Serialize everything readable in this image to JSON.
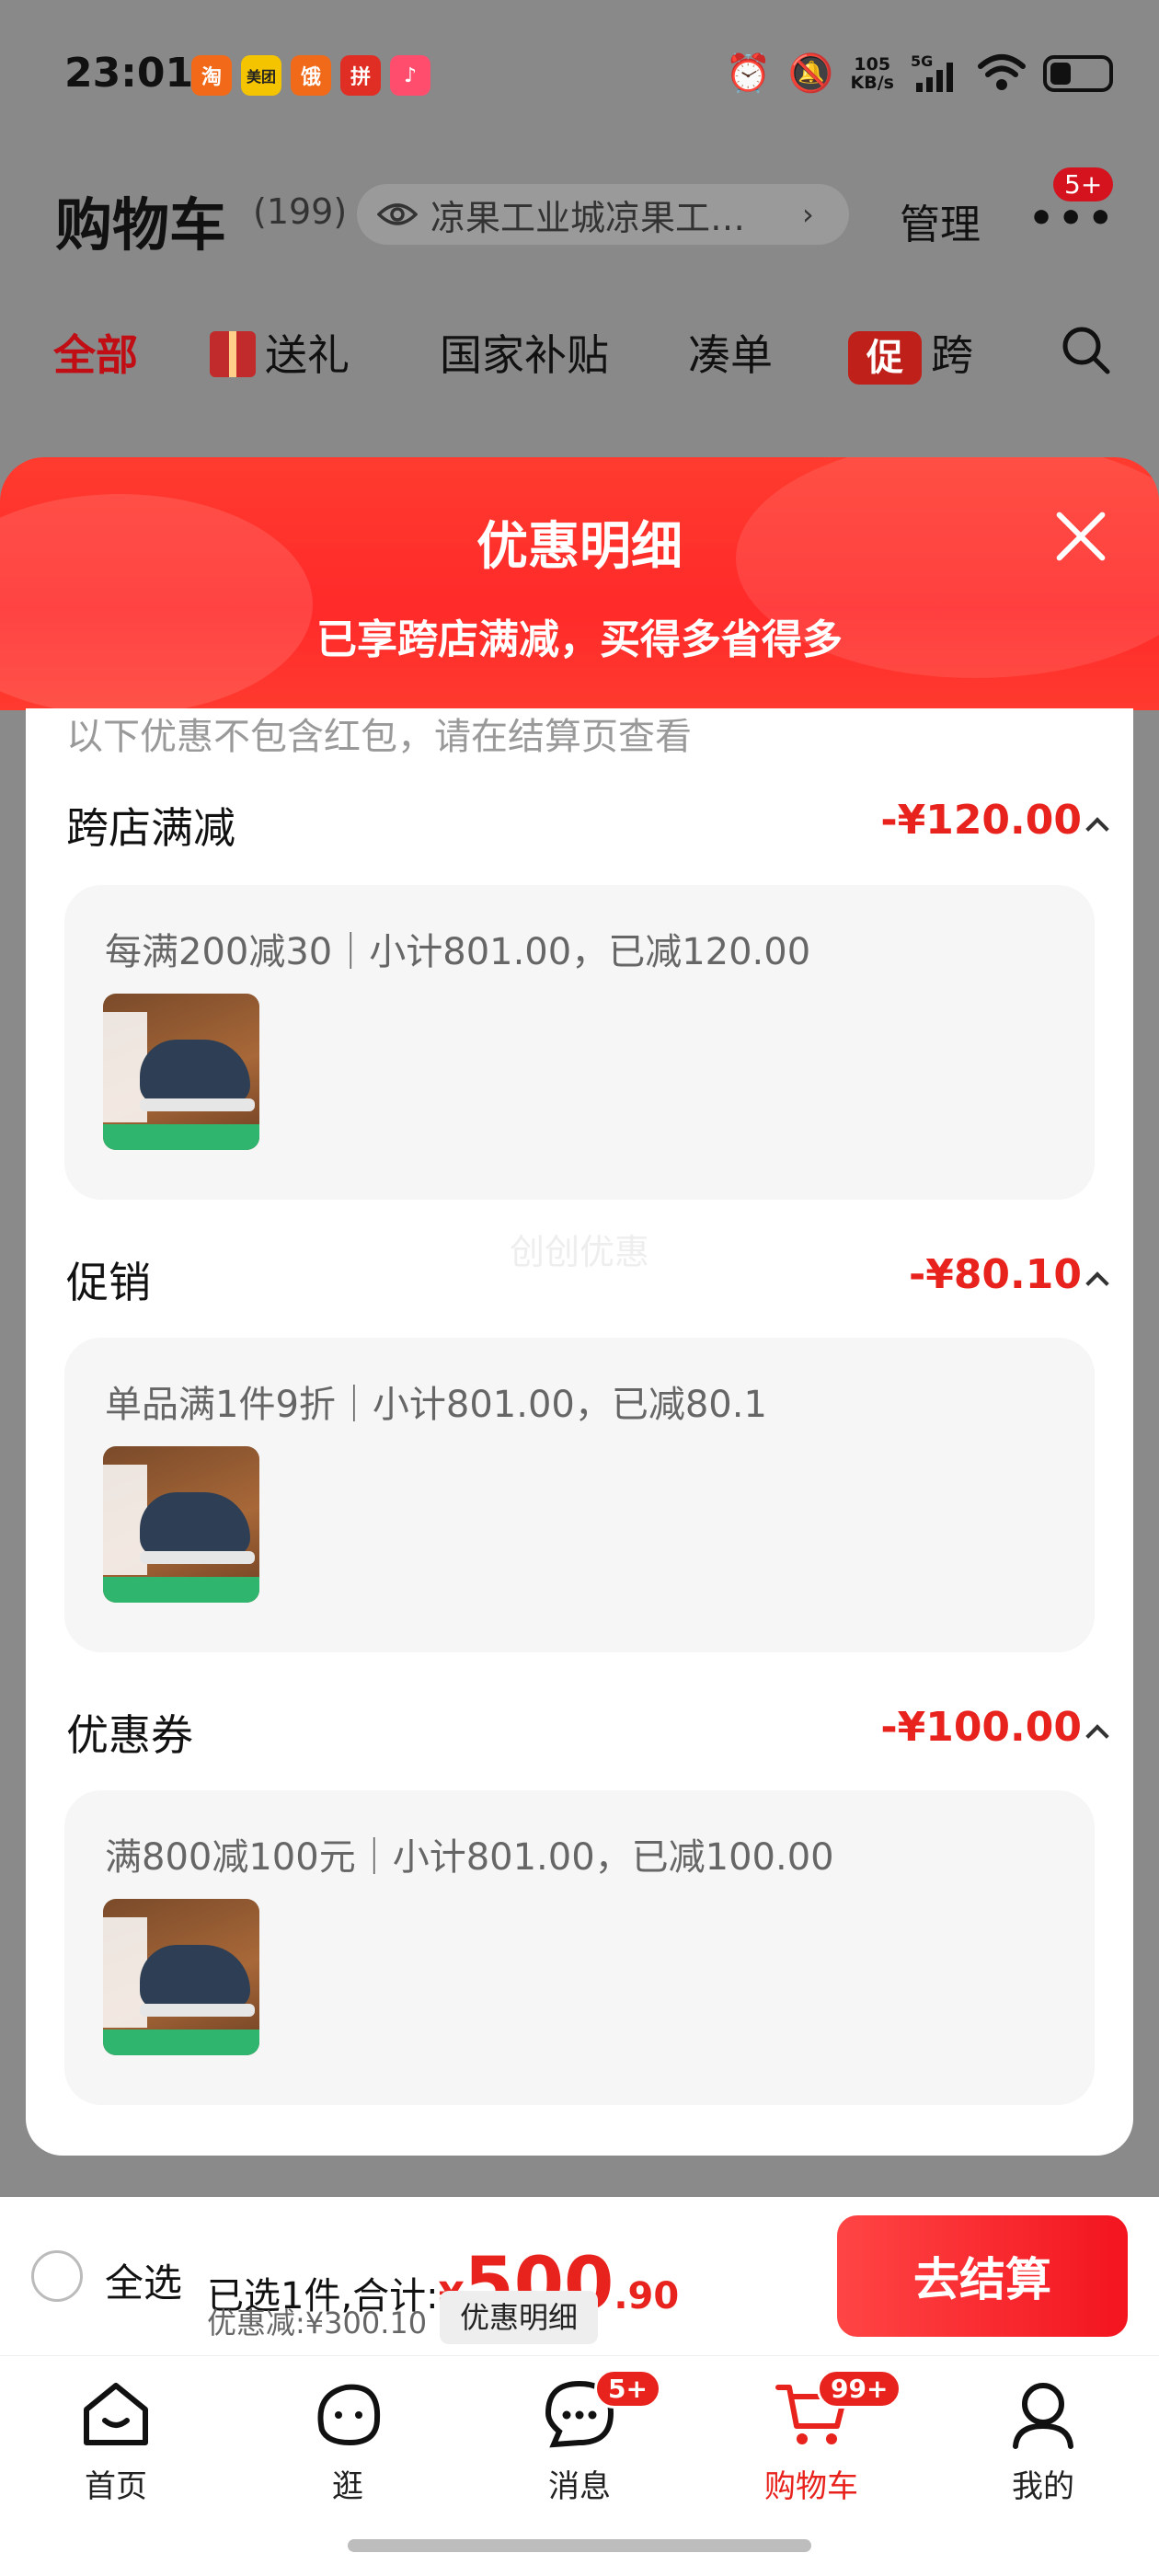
{
  "status_bar": {
    "time": "23:01",
    "app_badges": [
      {
        "label": "淘",
        "color": "#f26a19"
      },
      {
        "label": "美团",
        "color": "#f5c400"
      },
      {
        "label": "饿",
        "color": "#f06a1a"
      },
      {
        "label": "拼",
        "color": "#e02e24"
      },
      {
        "label": "♪",
        "color": "#ff4d6d"
      }
    ],
    "net_speed_value": "105",
    "net_speed_unit": "KB/s",
    "net_type": "5G"
  },
  "header": {
    "title": "购物车",
    "count": "(199)",
    "address": "凉果工业城凉果工…",
    "manage_label": "管理",
    "more_badge": "5+"
  },
  "category_tabs": [
    {
      "label": "全部",
      "active": true
    },
    {
      "label": "送礼",
      "active": false
    },
    {
      "label": "国家补贴",
      "active": false
    },
    {
      "label": "凑单",
      "active": false
    },
    {
      "label": "跨",
      "active": false
    }
  ],
  "promo_tag": "促",
  "sheet": {
    "title": "优惠明细",
    "subtitle": "已享跨店满减，买得多省得多",
    "note": "以下优惠不包含红包，请在结算页查看",
    "watermark": "创创优惠",
    "sections": [
      {
        "title": "跨店满减",
        "amount": "-¥120.00",
        "desc": "每满200减30｜小计801.00，已减120.00"
      },
      {
        "title": "促销",
        "amount": "-¥80.10",
        "desc": "单品满1件9折｜小计801.00，已减80.1"
      },
      {
        "title": "优惠券",
        "amount": "-¥100.00",
        "desc": "满800减100元｜小计801.00，已减100.00"
      }
    ]
  },
  "checkout": {
    "select_all": "全选",
    "selected_prefix": "已选1件,合计:",
    "currency": "¥",
    "price_int": "500",
    "price_dec": ".90",
    "discount_text": "优惠减:¥300.10",
    "detail_chip": "优惠明细",
    "button": "去结算"
  },
  "tabbar": [
    {
      "label": "首页",
      "badge": "",
      "active": false
    },
    {
      "label": "逛",
      "badge": "",
      "active": false
    },
    {
      "label": "消息",
      "badge": "5+",
      "active": false
    },
    {
      "label": "购物车",
      "badge": "99+",
      "active": true
    },
    {
      "label": "我的",
      "badge": "",
      "active": false
    }
  ]
}
